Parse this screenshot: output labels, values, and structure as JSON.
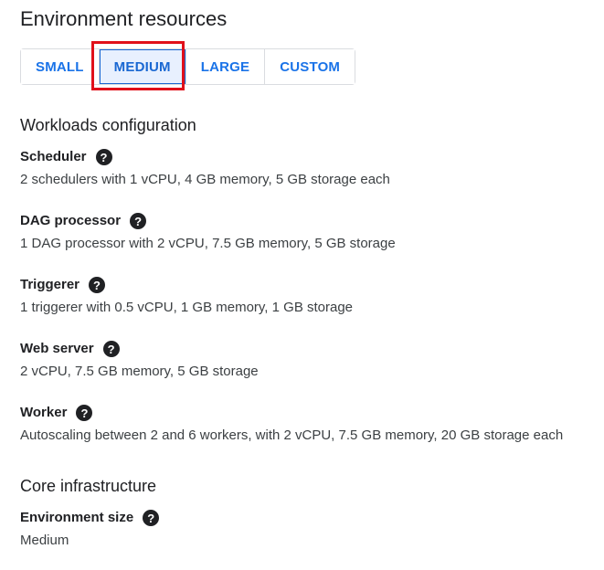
{
  "header": {
    "title": "Environment resources"
  },
  "size_selector": {
    "options": [
      "SMALL",
      "MEDIUM",
      "LARGE",
      "CUSTOM"
    ],
    "selected": "MEDIUM"
  },
  "workloads": {
    "heading": "Workloads configuration",
    "items": [
      {
        "label": "Scheduler",
        "value": "2 schedulers with 1 vCPU, 4 GB memory, 5 GB storage each"
      },
      {
        "label": "DAG processor",
        "value": "1 DAG processor with 2 vCPU, 7.5 GB memory, 5 GB storage"
      },
      {
        "label": "Triggerer",
        "value": "1 triggerer with 0.5 vCPU, 1 GB memory, 1 GB storage"
      },
      {
        "label": "Web server",
        "value": "2 vCPU, 7.5 GB memory, 5 GB storage"
      },
      {
        "label": "Worker",
        "value": "Autoscaling between 2 and 6 workers, with 2 vCPU, 7.5 GB memory, 20 GB storage each"
      }
    ]
  },
  "core_infrastructure": {
    "heading": "Core infrastructure",
    "items": [
      {
        "label": "Environment size",
        "value": "Medium"
      }
    ]
  },
  "icons": {
    "help": "help-circle-icon",
    "help_glyph": "?"
  },
  "colors": {
    "accent": "#1a73e8",
    "selected_bg": "#e8f0fe",
    "highlight": "#e0101a"
  }
}
